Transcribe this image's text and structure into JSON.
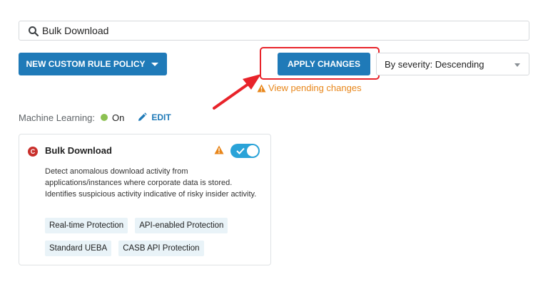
{
  "search": {
    "value": "Bulk Download",
    "placeholder": ""
  },
  "toolbar": {
    "new_rule_label": "NEW CUSTOM RULE POLICY",
    "apply_label": "APPLY CHANGES",
    "sort_value": "By severity: Descending",
    "pending_label": "View pending changes"
  },
  "ml": {
    "label": "Machine Learning:",
    "status": "On",
    "edit_label": "EDIT"
  },
  "card": {
    "severity_letter": "C",
    "title": "Bulk Download",
    "description": "Detect anomalous download activity from applications/instances where corporate data is stored. Identifies suspicious activity indicative of risky insider activity.",
    "enabled": true,
    "tags": [
      "Real-time Protection",
      "API-enabled Protection",
      "Standard UEBA",
      "CASB API Protection"
    ]
  },
  "colors": {
    "primary": "#1f7ab8",
    "highlight": "#e8232a",
    "warning": "#e8861a",
    "status_on": "#8cc152",
    "critical": "#c9302c",
    "toggle": "#2aa3d8",
    "tag_bg": "#e9f3f8"
  },
  "icons": [
    "search-icon",
    "caret-down-icon",
    "warning-icon",
    "pencil-icon",
    "check-icon",
    "annotation-arrow"
  ]
}
